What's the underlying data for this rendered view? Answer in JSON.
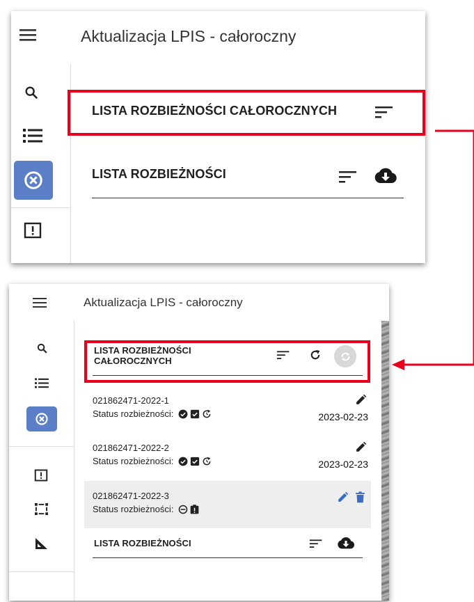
{
  "panel1": {
    "app_title": "Aktualizacja LPIS - całoroczny",
    "section1_title": "LISTA ROZBIEŻNOŚCI CAŁOROCZNYCH",
    "section2_title": "LISTA ROZBIEŻNOŚCI",
    "rail_icons": [
      "menu-icon",
      "search-icon",
      "list-icon",
      "cancel-circle-icon",
      "alert-box-icon"
    ]
  },
  "panel2": {
    "app_title": "Aktualizacja LPIS - całoroczny",
    "section1_title_line1": "LISTA ROZBIEŻNOŚCI",
    "section1_title_line2": "CAŁOROCZNYCH",
    "section2_title": "LISTA ROZBIEŻNOŚCI",
    "rail_icons": [
      "menu-icon",
      "search-icon",
      "list-icon",
      "cancel-circle-icon",
      "alert-box-icon",
      "select-box-icon",
      "measure-angle-icon"
    ],
    "items": [
      {
        "id": "021862471-2022-1",
        "status_label": "Status rozbieżności:",
        "date": "2023-02-23",
        "status_icons": [
          "check-circle-icon",
          "check-square-icon",
          "refresh-circle-icon"
        ]
      },
      {
        "id": "021862471-2022-2",
        "status_label": "Status rozbieżności:",
        "date": "2023-02-23",
        "status_icons": [
          "check-circle-icon",
          "check-square-icon",
          "refresh-circle-icon"
        ]
      },
      {
        "id": "021862471-2022-3",
        "status_label": "Status rozbieżności:",
        "date": "",
        "status_icons": [
          "minus-circle-icon",
          "clipboard-alert-icon"
        ]
      }
    ]
  },
  "colors": {
    "highlight": "#e8001c",
    "active_rail": "#5b7fc6",
    "edit_active": "#3a6cc4",
    "selected_row": "#eeeeee"
  }
}
